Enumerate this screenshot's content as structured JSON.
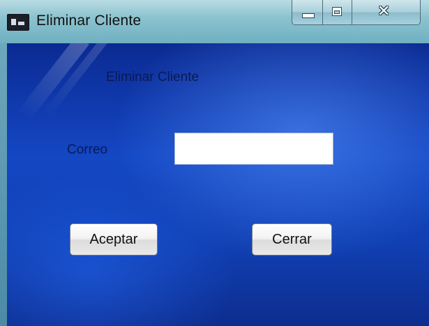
{
  "window": {
    "title": "Eliminar Cliente",
    "icon": "java-app-icon",
    "controls": [
      "minimize-icon",
      "maximize-icon",
      "close-icon"
    ]
  },
  "form": {
    "heading": "Eliminar Cliente",
    "email_label": "Correo",
    "email_value": "",
    "accept_label": "Aceptar",
    "close_label": "Cerrar"
  },
  "colors": {
    "titlebar": "#8cc3cf",
    "client_background": "#1447c4",
    "label_text": "#0a1a55"
  }
}
